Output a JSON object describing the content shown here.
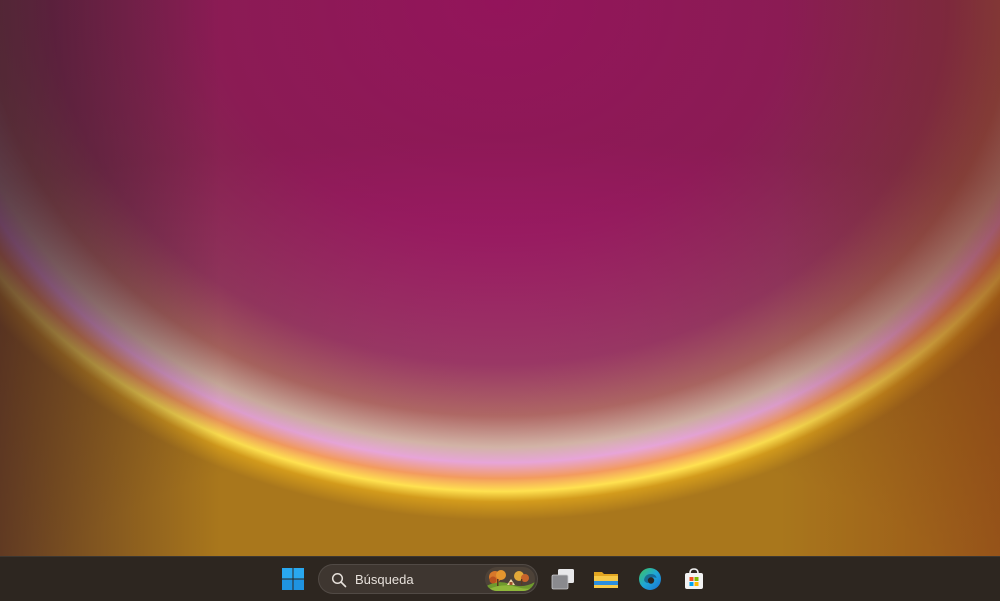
{
  "desktop": {
    "wallpaper": "bloom-sunset-wallpaper"
  },
  "taskbar": {
    "start_icon": "windows-start-icon",
    "search": {
      "placeholder": "Búsqueda",
      "icon": "search-icon",
      "highlight_icon": "autumn-landscape-icon"
    },
    "pinned": [
      {
        "name": "task-view-icon"
      },
      {
        "name": "file-explorer-icon"
      },
      {
        "name": "edge-browser-icon"
      },
      {
        "name": "microsoft-store-icon"
      }
    ]
  },
  "colors": {
    "taskbar_bg": "#2d2620",
    "windows_blue": "#29a8f0",
    "edge_blue": "#1f8de0",
    "edge_green": "#3fc45a",
    "folder_yellow": "#f4c03a"
  }
}
